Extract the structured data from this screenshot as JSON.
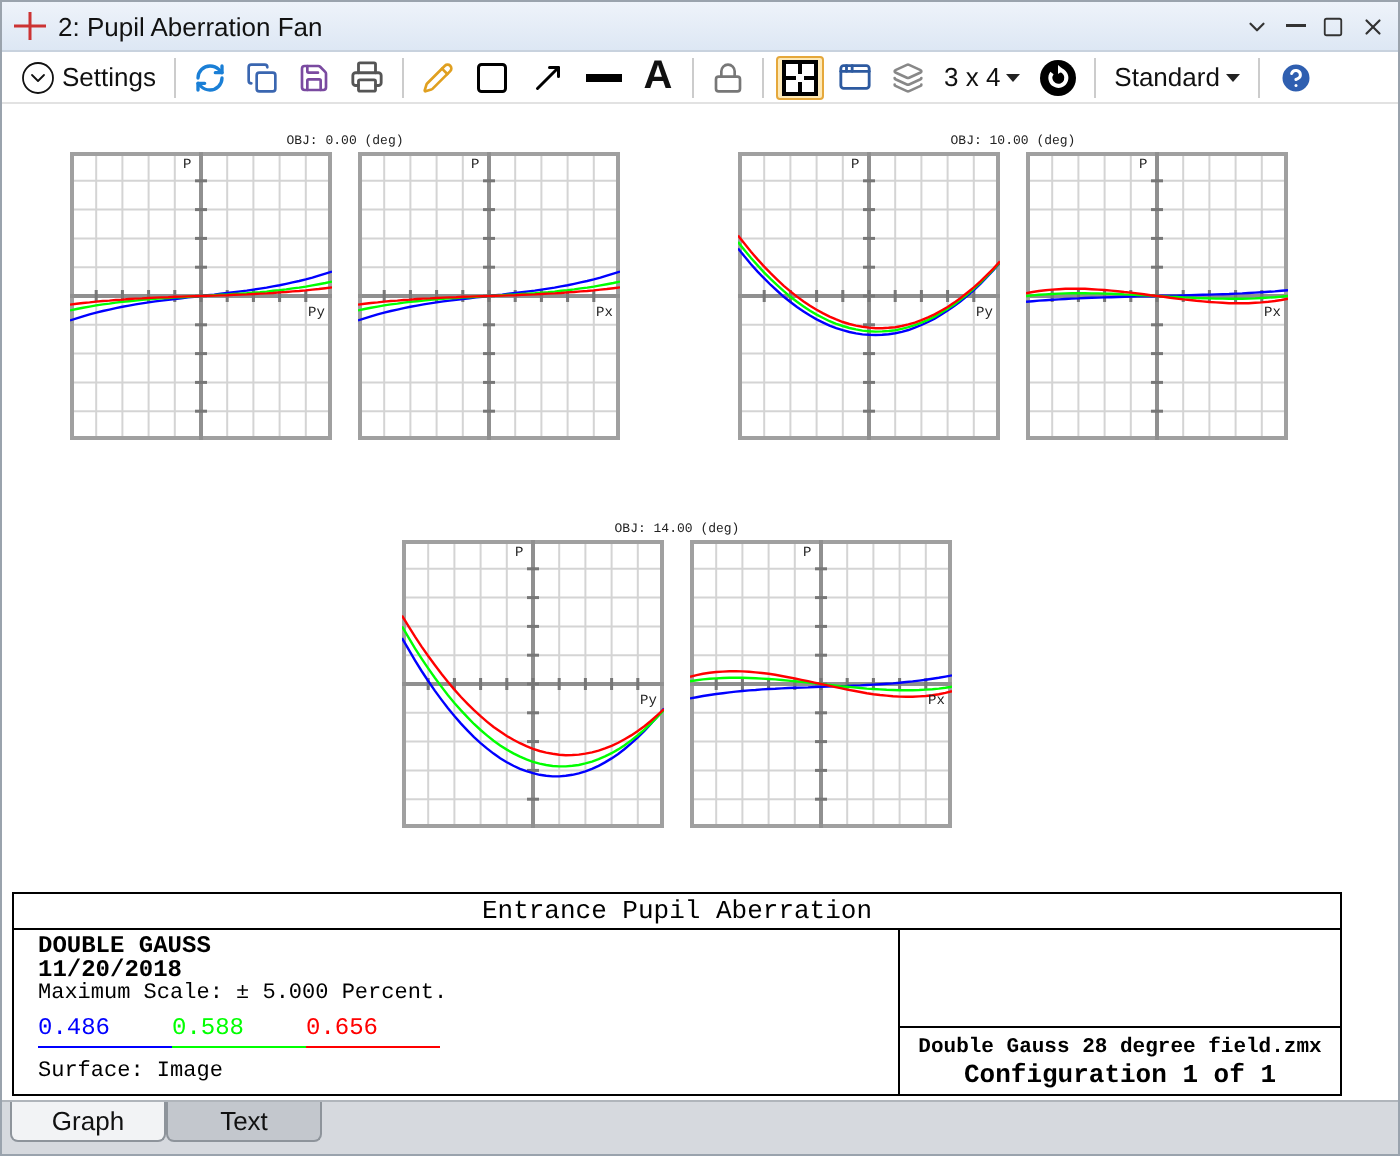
{
  "window": {
    "title": "2: Pupil Aberration Fan"
  },
  "toolbar": {
    "settings_label": "Settings",
    "text_tool_label": "A",
    "layout_label": "3 x 4",
    "style_label": "Standard",
    "grid_view_selected": true
  },
  "fields": [
    {
      "title": "OBJ: 0.00 (deg)",
      "plots": [
        {
          "vertical_label": "P",
          "horizontal_label": "Py"
        },
        {
          "vertical_label": "P",
          "horizontal_label": "Px"
        }
      ]
    },
    {
      "title": "OBJ: 10.00 (deg)",
      "plots": [
        {
          "vertical_label": "P",
          "horizontal_label": "Py"
        },
        {
          "vertical_label": "P",
          "horizontal_label": "Px"
        }
      ]
    },
    {
      "title": "OBJ: 14.00 (deg)",
      "plots": [
        {
          "vertical_label": "P",
          "horizontal_label": "Py"
        },
        {
          "vertical_label": "P",
          "horizontal_label": "Px"
        }
      ]
    }
  ],
  "info": {
    "title": "Entrance Pupil Aberration",
    "lens_name": "DOUBLE GAUSS",
    "date": "11/20/2018",
    "scale": "Maximum Scale: ± 5.000 Percent.",
    "wavelengths": [
      {
        "label": "0.486",
        "color": "#0000ff"
      },
      {
        "label": "0.588",
        "color": "#00ff00"
      },
      {
        "label": "0.656",
        "color": "#ff0000"
      }
    ],
    "surface": "Surface: Image",
    "file": "Double Gauss 28 degree field.zmx",
    "configuration": "Configuration 1 of 1"
  },
  "tabs": [
    {
      "label": "Graph",
      "selected": true
    },
    {
      "label": "Text",
      "selected": false
    }
  ]
}
